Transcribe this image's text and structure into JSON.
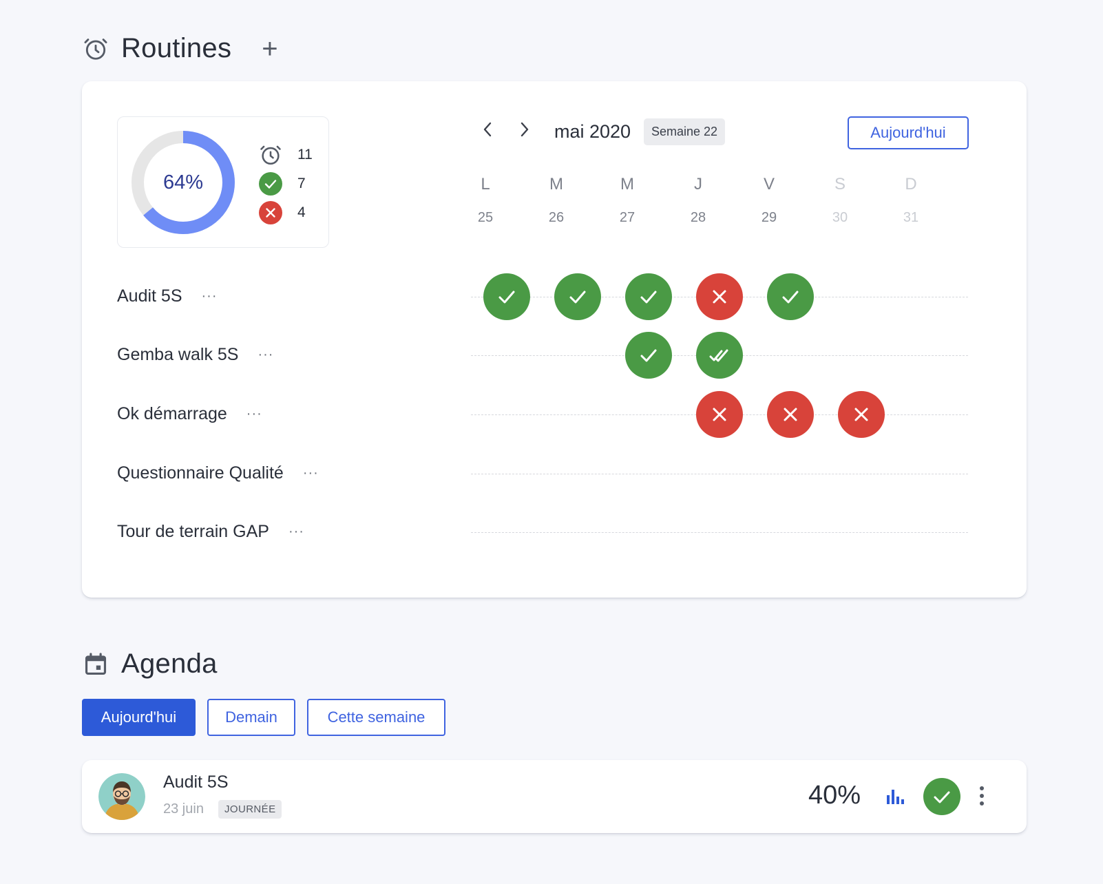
{
  "routines": {
    "title": "Routines",
    "icon": "alarm-clock-icon",
    "add_label": "+",
    "summary": {
      "percent": 64,
      "percent_label": "64%",
      "total": "11",
      "done": "7",
      "failed": "4"
    },
    "calendar": {
      "month": "mai 2020",
      "week": "Semaine 22",
      "today_label": "Aujourd'hui",
      "days": [
        {
          "letter": "L",
          "num": "25"
        },
        {
          "letter": "M",
          "num": "26"
        },
        {
          "letter": "M",
          "num": "27"
        },
        {
          "letter": "J",
          "num": "28"
        },
        {
          "letter": "V",
          "num": "29"
        },
        {
          "letter": "S",
          "num": "30"
        },
        {
          "letter": "D",
          "num": "31"
        }
      ]
    },
    "items": [
      {
        "name": "Audit 5S",
        "more": "···",
        "statuses": [
          "ok",
          "ok",
          "ok",
          "fail",
          "ok",
          null,
          null
        ]
      },
      {
        "name": "Gemba walk 5S",
        "more": "···",
        "statuses": [
          null,
          null,
          "ok",
          "double-ok",
          null,
          null,
          null
        ]
      },
      {
        "name": "Ok démarrage",
        "more": "···",
        "statuses": [
          null,
          null,
          null,
          "fail",
          "fail",
          "fail",
          null
        ]
      },
      {
        "name": "Questionnaire Qualité",
        "more": "···",
        "statuses": [
          null,
          null,
          null,
          null,
          null,
          null,
          null
        ]
      },
      {
        "name": "Tour de terrain GAP",
        "more": "···",
        "statuses": [
          null,
          null,
          null,
          null,
          null,
          null,
          null
        ]
      }
    ]
  },
  "agenda": {
    "title": "Agenda",
    "icon": "calendar-icon",
    "filters": [
      {
        "label": "Aujourd'hui",
        "active": true
      },
      {
        "label": "Demain",
        "active": false
      },
      {
        "label": "Cette semaine",
        "active": false
      }
    ],
    "entry": {
      "title": "Audit 5S",
      "date": "23 juin",
      "badge": "JOURNÉE",
      "percent": "40%",
      "stats_icon": "bar-chart-icon",
      "status": "ok",
      "menu_icon": "more-vertical-icon"
    }
  },
  "colors": {
    "accent": "#3f63e0",
    "accent_dark": "#2d5ad8",
    "ok": "#4a9a45",
    "fail": "#d8433a",
    "donut_track": "#e6e6e6",
    "donut_fill": "#6f8df6"
  }
}
